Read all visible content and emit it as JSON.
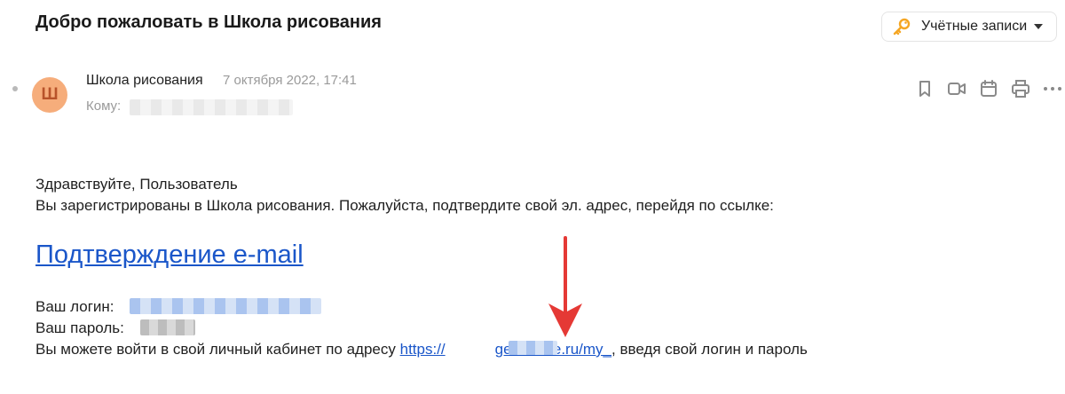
{
  "email": {
    "subject": "Добро пожаловать в Школа рисования",
    "sender_name": "Школа рисования",
    "avatar_letter": "Ш",
    "date": "7 октября 2022, 17:41",
    "to_label": "Кому:"
  },
  "header": {
    "accounts_label": "Учётные записи"
  },
  "toolbar": {
    "icons": [
      "bookmark-icon",
      "video-icon",
      "calendar-icon",
      "print-icon",
      "more-icon"
    ]
  },
  "body": {
    "greeting": "Здравствуйте, Пользователь",
    "registered_text": "Вы зарегистрированы в Школа рисования. Пожалуйста, подтвердите свой эл. адрес, перейдя по ссылке:",
    "confirm_link": "Подтверждение e-mail",
    "login_label": "Ваш логин:",
    "password_label": "Ваш пароль:",
    "cabinet_text": "Вы можете войти в свой личный кабинет по адресу",
    "url_prefix": "https://",
    "url_suffix": "getcourse.ru/my_",
    "cabinet_suffix": ", введя свой логин и пароль"
  },
  "colors": {
    "link": "#1a56c9",
    "avatar_bg": "#f6ad7b",
    "arrow": "#e53935"
  }
}
